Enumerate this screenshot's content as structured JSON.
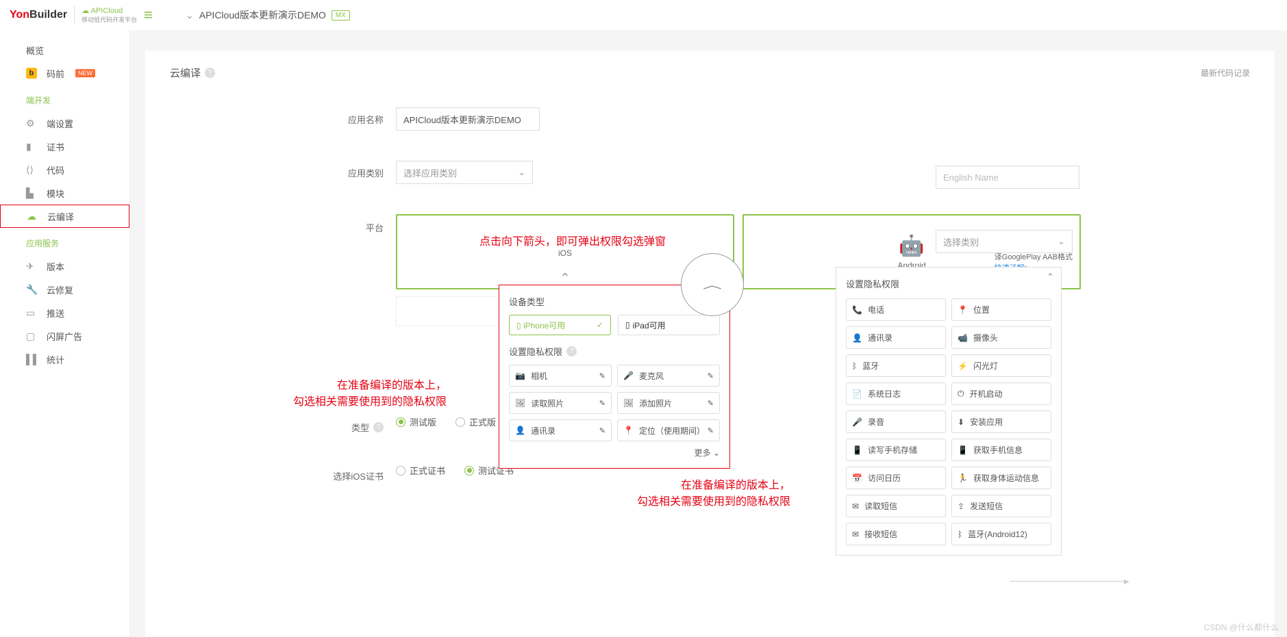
{
  "header": {
    "logo1": "Yon",
    "logo2": "Builder",
    "apicloud": "☁ APICloud",
    "apicloud_sub": "移动低代码开发平台",
    "breadcrumb_title": "APICloud版本更新演示DEMO",
    "mx": "MX"
  },
  "sidebar": {
    "overview": "概览",
    "maqian": "码前",
    "new": "NEW",
    "sect_dev": "端开发",
    "items_dev": [
      "端设置",
      "证书",
      "代码",
      "模块",
      "云编译"
    ],
    "sect_svc": "应用服务",
    "items_svc": [
      "版本",
      "云修复",
      "推送",
      "闪屏广告",
      "统计"
    ]
  },
  "section": {
    "title": "云编译",
    "latest": "最新代码记录"
  },
  "form": {
    "app_name_label": "应用名称",
    "app_name_value": "APICloud版本更新演示DEMO",
    "english_placeholder": "English Name",
    "app_cat_label": "应用类别",
    "app_cat_placeholder": "选择应用类别",
    "cat2_placeholder": "选择类别",
    "platform_label": "平台",
    "type_label": "类型",
    "cert_label": "选择iOS证书",
    "type_test": "测试版",
    "type_prod": "正式版",
    "cert_prod": "正式证书",
    "cert_test": "测试证书"
  },
  "platforms": {
    "ios": "iOS",
    "android": "Android",
    "android_note": "译GooglePlay AAB格式",
    "android_link": "快速了解>"
  },
  "popup_ios": {
    "device_label": "设备类型",
    "iphone": "iPhone可用",
    "ipad": "iPad可用",
    "perm_label": "设置隐私权限",
    "perms": [
      {
        "icon": "📷",
        "label": "相机"
      },
      {
        "icon": "🎤",
        "label": "麦克风"
      },
      {
        "icon": "🖼",
        "label": "读取照片"
      },
      {
        "icon": "🖼",
        "label": "添加照片"
      },
      {
        "icon": "👤",
        "label": "通讯录"
      },
      {
        "icon": "📍",
        "label": "定位（使用期间）"
      }
    ],
    "more": "更多"
  },
  "android_panel": {
    "title": "设置隐私权限",
    "perms_left": [
      {
        "icon": "📞",
        "label": "电话"
      },
      {
        "icon": "👤",
        "label": "通讯录"
      },
      {
        "icon": "ᛒ",
        "label": "蓝牙"
      },
      {
        "icon": "📄",
        "label": "系统日志"
      },
      {
        "icon": "🎤",
        "label": "录音"
      },
      {
        "icon": "📱",
        "label": "读写手机存储"
      },
      {
        "icon": "📅",
        "label": "访问日历"
      },
      {
        "icon": "✉",
        "label": "读取短信"
      },
      {
        "icon": "✉",
        "label": "接收短信"
      }
    ],
    "perms_right": [
      {
        "icon": "📍",
        "label": "位置"
      },
      {
        "icon": "📹",
        "label": "摄像头"
      },
      {
        "icon": "⚡",
        "label": "闪光灯"
      },
      {
        "icon": "⏻",
        "label": "开机启动"
      },
      {
        "icon": "⬇",
        "label": "安装应用"
      },
      {
        "icon": "📱",
        "label": "获取手机信息"
      },
      {
        "icon": "🏃",
        "label": "获取身体运动信息"
      },
      {
        "icon": "⇪",
        "label": "发送短信"
      },
      {
        "icon": "ᛒ",
        "label": "蓝牙(Android12)"
      }
    ]
  },
  "annotations": {
    "a1": "点击向下箭头，即可弹出权限勾选弹窗",
    "a2a": "在准备编译的版本上，",
    "a2b": "勾选相关需要使用到的隐私权限",
    "a3a": "在准备编译的版本上，",
    "a3b": "勾选相关需要使用到的隐私权限"
  },
  "watermark": "CSDN @什么都什么"
}
